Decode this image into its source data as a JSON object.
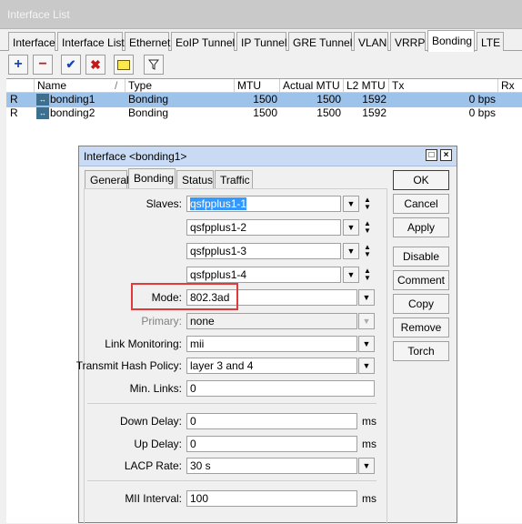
{
  "window": {
    "title": "Interface List"
  },
  "tabs": [
    "Interface",
    "Interface List",
    "Ethernet",
    "EoIP Tunnel",
    "IP Tunnel",
    "GRE Tunnel",
    "VLAN",
    "VRRP",
    "Bonding",
    "LTE"
  ],
  "toolbar": {
    "add_icon": "plus-icon",
    "remove_icon": "minus-icon",
    "enable_icon": "check-icon",
    "disable_icon": "x-icon",
    "comment_icon": "note-icon",
    "filter_icon": "funnel-icon"
  },
  "table": {
    "columns": [
      "Name",
      "Type",
      "MTU",
      "Actual MTU",
      "L2 MTU",
      "Tx",
      "Rx"
    ],
    "sort_indicator": "/",
    "rows": [
      {
        "flag": "R",
        "name": "bonding1",
        "type": "Bonding",
        "mtu": "1500",
        "actual_mtu": "1500",
        "l2_mtu": "1592",
        "tx": "0 bps"
      },
      {
        "flag": "R",
        "name": "bonding2",
        "type": "Bonding",
        "mtu": "1500",
        "actual_mtu": "1500",
        "l2_mtu": "1592",
        "tx": "0 bps"
      }
    ]
  },
  "dialog": {
    "title": "Interface <bonding1>",
    "tabs": [
      "General",
      "Bonding",
      "Status",
      "Traffic"
    ],
    "fields": {
      "slaves_label": "Slaves:",
      "slaves": [
        "qsfpplus1-1",
        "qsfpplus1-2",
        "qsfpplus1-3",
        "qsfpplus1-4"
      ],
      "mode_label": "Mode:",
      "mode": "802.3ad",
      "primary_label": "Primary:",
      "primary": "none",
      "link_monitoring_label": "Link Monitoring:",
      "link_monitoring": "mii",
      "hash_policy_label": "Transmit Hash Policy:",
      "hash_policy": "layer 3 and 4",
      "min_links_label": "Min. Links:",
      "min_links": "0",
      "down_delay_label": "Down Delay:",
      "down_delay": "0",
      "up_delay_label": "Up Delay:",
      "up_delay": "0",
      "lacp_rate_label": "LACP Rate:",
      "lacp_rate": "30 s",
      "mii_interval_label": "MII Interval:",
      "mii_interval": "100",
      "unit_ms": "ms"
    },
    "buttons": [
      "OK",
      "Cancel",
      "Apply",
      "Disable",
      "Comment",
      "Copy",
      "Remove",
      "Torch"
    ]
  },
  "colors": {
    "selection": "#9ec3ea",
    "highlight_box": "#e23a3a",
    "dialog_title": "#c9dbf4"
  }
}
